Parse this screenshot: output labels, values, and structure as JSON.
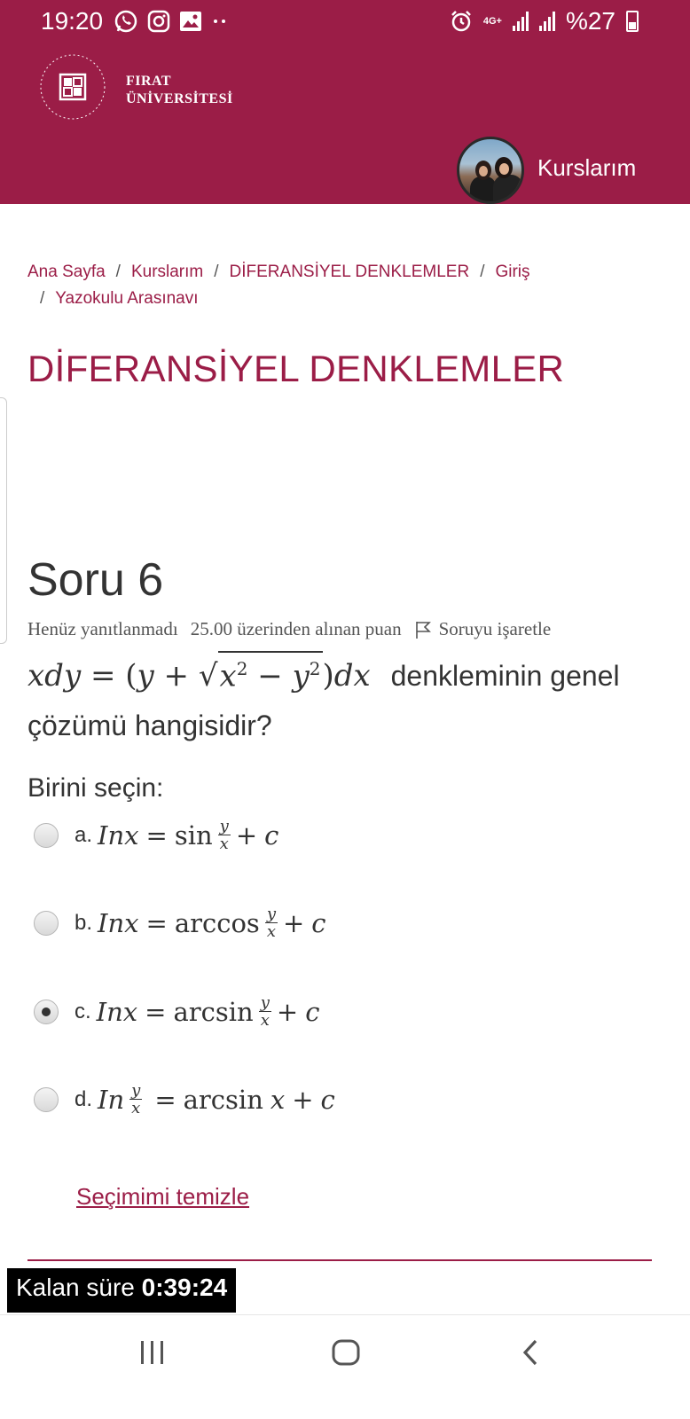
{
  "status_bar": {
    "time": "19:20",
    "network": "4G+",
    "battery": "%27"
  },
  "header": {
    "logo_line1": "FIRAT",
    "logo_line2": "ÜNİVERSİTESİ",
    "nav_link": "Kurslarım"
  },
  "breadcrumb": {
    "items": [
      "Ana Sayfa",
      "Kurslarım",
      "DİFERANSİYEL DENKLEMLER",
      "Giriş",
      "Yazokulu Arasınavı"
    ],
    "separator": "/"
  },
  "course_title": "DİFERANSİYEL DENKLEMLER",
  "question": {
    "number_label": "Soru 6",
    "status": "Henüz yanıtlanmadı",
    "points": "25.00 üzerinden alınan puan",
    "flag_label": "Soruyu işaretle",
    "text_suffix": "denkleminin genel çözümü hangisidir?",
    "choose_label": "Birini seçin:",
    "options": [
      {
        "letter": "a.",
        "selected": false
      },
      {
        "letter": "b.",
        "selected": false
      },
      {
        "letter": "c.",
        "selected": true
      },
      {
        "letter": "d.",
        "selected": false
      }
    ],
    "clear_label": "Seçimimi temizle"
  },
  "timer": {
    "label": "Kalan süre",
    "value": "0:39:24"
  },
  "colors": {
    "brand": "#9b1d47"
  },
  "nav_icons": [
    "recent-apps-icon",
    "home-icon",
    "back-icon"
  ]
}
